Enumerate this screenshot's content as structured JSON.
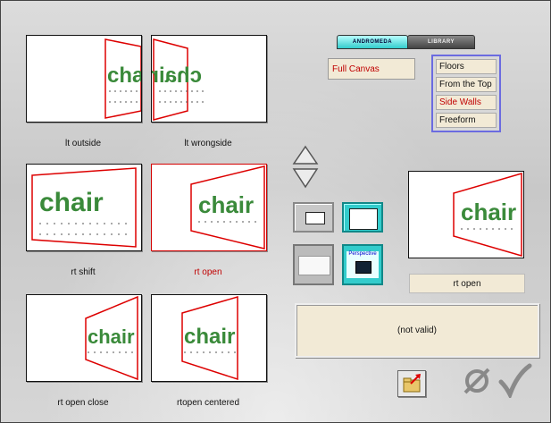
{
  "tabs": [
    {
      "label": "ANDROMEDA",
      "active": true
    },
    {
      "label": "LIBRARY",
      "active": false
    }
  ],
  "dropdown": {
    "value": "Full Canvas"
  },
  "menu": {
    "items": [
      {
        "label": "Floors",
        "selected": false
      },
      {
        "label": "From the Top",
        "selected": false
      },
      {
        "label": "Side Walls",
        "selected": true
      },
      {
        "label": "Freeform",
        "selected": false
      }
    ]
  },
  "thumbnails": [
    {
      "caption": "lt outside",
      "selected": false
    },
    {
      "caption": "lt wrongside",
      "selected": false
    },
    {
      "caption": "rt shift",
      "selected": false
    },
    {
      "caption": "rt open",
      "selected": true
    },
    {
      "caption": "rt open close",
      "selected": false
    },
    {
      "caption": "rtopen centered",
      "selected": false
    }
  ],
  "thumbnail_text": "chair",
  "preview": {
    "label": "rt open",
    "text": "chair"
  },
  "format_buttons": {
    "perspective_label": "Perspective"
  },
  "status": {
    "text": "(not valid)"
  },
  "colors": {
    "accent_red": "#c00000",
    "text_green": "#3a8a3a",
    "menu_border": "#6b6be0",
    "tab_cyan": "#33cccc"
  },
  "icons": [
    "arrow-up-icon",
    "arrow-down-icon",
    "folder-export-icon",
    "cancel-icon",
    "checkmark-icon"
  ]
}
